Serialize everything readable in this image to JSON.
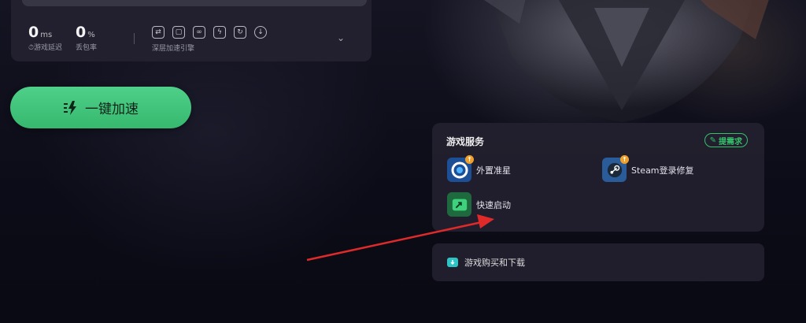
{
  "stats": {
    "latency": {
      "value": "0",
      "unit": "ms",
      "label": "游戏延迟"
    },
    "loss": {
      "value": "0",
      "unit": "%",
      "label": "丢包率"
    },
    "deep_engine_label": "深层加速引擎"
  },
  "toolbar": {
    "icons": [
      "swap-icon",
      "monitor-icon",
      "link-icon",
      "bolt-icon",
      "refresh-icon",
      "download-icon"
    ]
  },
  "accelerate_button": {
    "label": "一键加速"
  },
  "game_services": {
    "title": "游戏服务",
    "request_label": "提需求",
    "items": [
      {
        "label": "外置准星",
        "icon": "crosshair-icon"
      },
      {
        "label": "Steam登录修复",
        "icon": "steam-icon"
      },
      {
        "label": "快速启动",
        "icon": "quick-launch-icon"
      }
    ]
  },
  "purchase": {
    "label": "游戏购买和下载",
    "icon": "cloud-download-icon"
  },
  "colors": {
    "accent_green": "#3ec47a",
    "badge_orange": "#f0a02a",
    "arrow_red": "#e02a2a"
  }
}
